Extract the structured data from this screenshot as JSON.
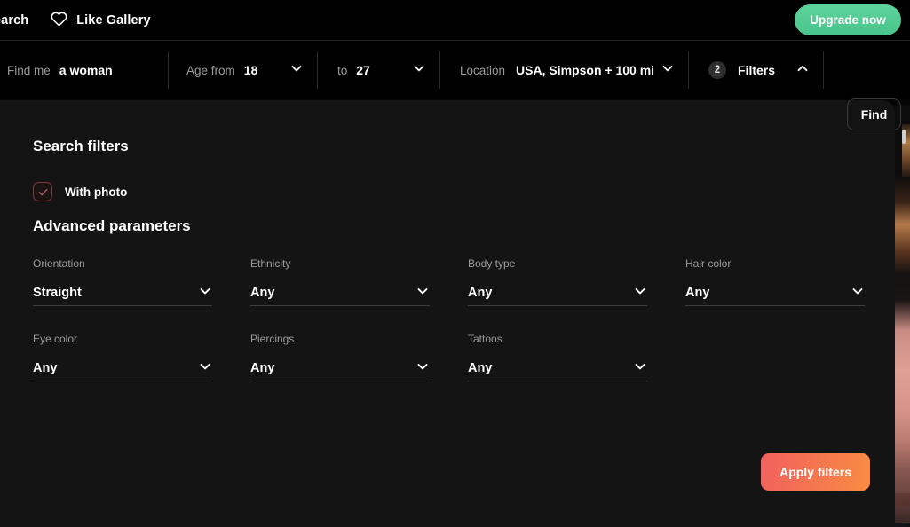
{
  "topnav": {
    "search_label": "earch",
    "like_gallery_label": "Like Gallery",
    "heart_icon": "heart-icon",
    "upgrade_label": "Upgrade now",
    "upgrade_color": "#4ec596"
  },
  "searchbar": {
    "find_me": {
      "label": "Find me",
      "value": "a woman"
    },
    "age_from": {
      "label": "Age from",
      "value": "18",
      "icon": "chevron-down-icon"
    },
    "age_to": {
      "label": "to",
      "value": "27",
      "icon": "chevron-down-icon"
    },
    "location": {
      "label": "Location",
      "value": "USA, Simpson + 100 mi",
      "icon": "chevron-down-icon"
    },
    "filters": {
      "badge": "2",
      "label": "Filters",
      "icon": "chevron-up-icon"
    },
    "find_button": "Find"
  },
  "panel": {
    "title": "Search filters",
    "with_photo": {
      "label": "With photo",
      "checked": true,
      "accent": "#7a3b3b"
    },
    "advanced_title": "Advanced parameters",
    "fields": [
      {
        "label": "Orientation",
        "value": "Straight",
        "name": "orientation"
      },
      {
        "label": "Ethnicity",
        "value": "Any",
        "name": "ethnicity"
      },
      {
        "label": "Body type",
        "value": "Any",
        "name": "body-type"
      },
      {
        "label": "Hair color",
        "value": "Any",
        "name": "hair-color"
      },
      {
        "label": "Eye color",
        "value": "Any",
        "name": "eye-color"
      },
      {
        "label": "Piercings",
        "value": "Any",
        "name": "piercings"
      },
      {
        "label": "Tattoos",
        "value": "Any",
        "name": "tattoos"
      }
    ],
    "apply_label": "Apply filters",
    "apply_gradient_from": "#f2605f",
    "apply_gradient_to": "#fa8c43"
  }
}
